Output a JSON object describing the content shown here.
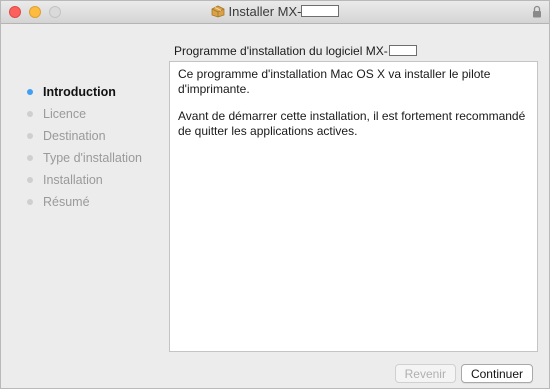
{
  "window": {
    "title": "Installer MX-",
    "icon": "installer-package-icon",
    "lock_icon": "lock-icon"
  },
  "header": {
    "text": "Programme d'installation du logiciel MX-"
  },
  "sidebar": {
    "steps": [
      {
        "label": "Introduction",
        "active": true
      },
      {
        "label": "Licence",
        "active": false
      },
      {
        "label": "Destination",
        "active": false
      },
      {
        "label": "Type d'installation",
        "active": false
      },
      {
        "label": "Installation",
        "active": false
      },
      {
        "label": "Résumé",
        "active": false
      }
    ]
  },
  "content": {
    "paragraphs": [
      "Ce programme d'installation Mac OS X va installer le pilote d'imprimante.",
      "Avant de démarrer cette installation, il est fortement recommandé de quitter les applications actives."
    ]
  },
  "buttons": {
    "back_label": "Revenir",
    "continue_label": "Continuer"
  },
  "colors": {
    "active_dot": "#3f9ff5",
    "close": "#fc605c",
    "minimize": "#fdbc40"
  }
}
